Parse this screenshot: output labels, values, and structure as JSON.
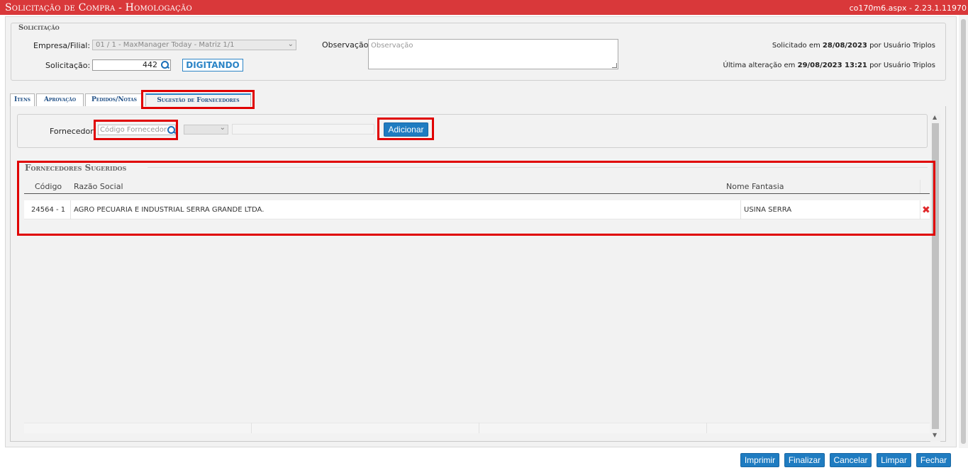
{
  "window": {
    "title": "Solicitação de Compra  - Homologação",
    "version": "co170m6.aspx - 2.23.1.11970"
  },
  "solicitacao": {
    "legend": "Solicitação",
    "empresa_label": "Empresa/Filial:",
    "empresa_value": "01 / 1 - MaxManager Today - Matriz 1/1",
    "solicitacao_label": "Solicitação:",
    "solicitacao_value": "442",
    "status": "DIGITANDO",
    "observacao_label": "Observação:",
    "observacao_placeholder": "Observação",
    "solicitado_prefix": "Solicitado em",
    "solicitado_date": "28/08/2023",
    "solicitado_by": "por Usuário Triplos",
    "alteracao_prefix": "Última alteração em",
    "alteracao_date": "29/08/2023 13:21",
    "alteracao_by": "por Usuário Triplos"
  },
  "tabs": [
    {
      "label": "Itens"
    },
    {
      "label": "Aprovação"
    },
    {
      "label": "Pedidos/Notas"
    },
    {
      "label": "Sugestão de Fornecedores"
    }
  ],
  "fornecedor": {
    "label": "Fornecedor:",
    "placeholder": "Código Fornecedor",
    "add_button": "Adicionar"
  },
  "sugeridos": {
    "title": "Fornecedores Sugeridos",
    "columns": [
      "Código",
      "Razão Social",
      "Nome Fantasia"
    ],
    "rows": [
      {
        "codigo": "24564 - 1",
        "razao_social": "AGRO PECUARIA E INDUSTRIAL SERRA GRANDE LTDA.",
        "nome_fantasia": "USINA SERRA"
      }
    ]
  },
  "footer": {
    "imprimir": "Imprimir",
    "finalizar": "Finalizar",
    "cancelar": "Cancelar",
    "limpar": "Limpar",
    "fechar": "Fechar"
  },
  "colors": {
    "titlebar": "#d9383a",
    "accent": "#1f7cc1",
    "highlight": "#e00000"
  }
}
